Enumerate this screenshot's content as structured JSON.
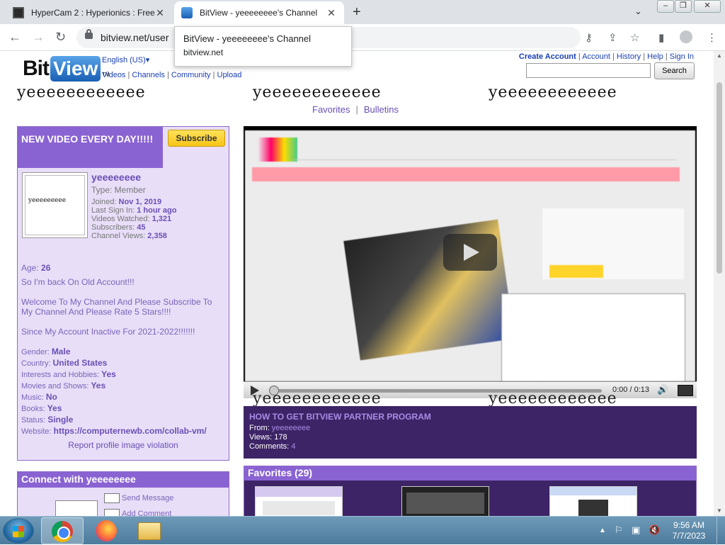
{
  "browser": {
    "tabs": [
      {
        "title": "HyperCam 2 : Hyperionics : Free",
        "close": "✕"
      },
      {
        "title": "BitView - yeeeeeeee's Channel",
        "close": "✕"
      }
    ],
    "new_tab": "+",
    "tab_search": "⌄",
    "url": "bitview.net/user",
    "tooltip": {
      "title": "BitView - yeeeeeeee's Channel",
      "domain": "bitview.net"
    },
    "icons": [
      "back-icon",
      "forward-icon",
      "reload-icon",
      "lock-icon",
      "key-icon",
      "share-icon",
      "star-icon",
      "side-panel-icon",
      "profile-icon",
      "menu-icon"
    ]
  },
  "site": {
    "logo_bit": "Bit",
    "logo_view": "View",
    "logo_tm": "TM",
    "language": "English (US)▾",
    "nav": [
      "Videos",
      "Channels",
      "Community",
      "Upload"
    ],
    "user_nav": [
      "Create Account",
      "Account",
      "History",
      "Help",
      "Sign In"
    ],
    "search_button": "Search",
    "search_value": ""
  },
  "channel": {
    "banner_text": "yeeeeeeeeeeee",
    "subnav": [
      "Favorites",
      "Bulletins"
    ],
    "header": "NEW VIDEO EVERY DAY!!!!!",
    "subscribe": "Subscribe",
    "avatar_text": "yeeeeeeeee",
    "username": "yeeeeeeee",
    "type": "Type: Member",
    "stats": [
      {
        "label": "Joined:",
        "value": "Nov 1, 2019"
      },
      {
        "label": "Last Sign In:",
        "value": "1 hour ago"
      },
      {
        "label": "Videos Watched:",
        "value": "1,321"
      },
      {
        "label": "Subscribers:",
        "value": "45"
      },
      {
        "label": "Channel Views:",
        "value": "2,358"
      }
    ],
    "age_label": "Age:",
    "age": "26",
    "bio": [
      "So I'm back On Old Account!!!",
      "Welcome To My Channel And Please Subscribe To",
      "My Channel And Please Rate 5 Stars!!!!",
      "Since My Account Inactive For 2021-2022!!!!!!!"
    ],
    "details": [
      {
        "label": "Gender:",
        "value": "Male"
      },
      {
        "label": "Country:",
        "value": "United States"
      },
      {
        "label": "Interests and Hobbies:",
        "value": "Yes"
      },
      {
        "label": "Movies and Shows:",
        "value": "Yes"
      },
      {
        "label": "Music:",
        "value": "No"
      },
      {
        "label": "Books:",
        "value": "Yes"
      },
      {
        "label": "Status:",
        "value": "Single"
      },
      {
        "label": "Website:",
        "value": "https://computernewb.com/collab-vm/"
      }
    ],
    "report": "Report profile image violation",
    "connect_header": "Connect with yeeeeeeee",
    "connect_links": [
      "Send Message",
      "Add Comment"
    ]
  },
  "video": {
    "time": "0:00 / 0:13",
    "title": "HOW TO GET BITVIEW PARTNER PROGRAM",
    "from_label": "From:",
    "from": "yeeeeeeee",
    "views": "Views: 178",
    "comments_label": "Comments:",
    "comments": "4",
    "progress": 0
  },
  "favorites": {
    "header": "Favorites (29)"
  },
  "taskbar": {
    "time": "9:56 AM",
    "date": "7/7/2023",
    "tray": [
      "▲",
      "⚐",
      "▣",
      "🔇"
    ]
  }
}
